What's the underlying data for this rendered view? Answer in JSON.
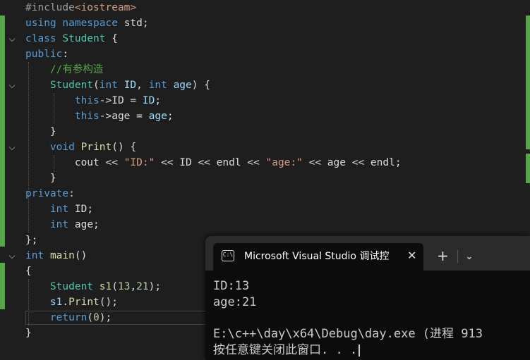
{
  "editor": {
    "lines": [
      {
        "parts": [
          {
            "c": "pp",
            "t": "#include"
          },
          {
            "c": "str",
            "t": "<iostream>"
          }
        ]
      },
      {
        "parts": [
          {
            "c": "kw",
            "t": "using"
          },
          {
            "c": "",
            "t": " "
          },
          {
            "c": "kw",
            "t": "namespace"
          },
          {
            "c": "",
            "t": " std;"
          }
        ]
      },
      {
        "parts": [
          {
            "c": "kw",
            "t": "class"
          },
          {
            "c": "",
            "t": " "
          },
          {
            "c": "ty",
            "t": "Student"
          },
          {
            "c": "",
            "t": " {"
          }
        ]
      },
      {
        "parts": [
          {
            "c": "kw",
            "t": "public"
          },
          {
            "c": "",
            "t": ":"
          }
        ]
      },
      {
        "parts": [
          {
            "c": "",
            "t": "    "
          },
          {
            "c": "cm",
            "t": "//有参构造"
          }
        ]
      },
      {
        "parts": [
          {
            "c": "",
            "t": "    "
          },
          {
            "c": "ty",
            "t": "Student"
          },
          {
            "c": "",
            "t": "("
          },
          {
            "c": "kw",
            "t": "int"
          },
          {
            "c": "",
            "t": " "
          },
          {
            "c": "var",
            "t": "ID"
          },
          {
            "c": "",
            "t": ", "
          },
          {
            "c": "kw",
            "t": "int"
          },
          {
            "c": "",
            "t": " "
          },
          {
            "c": "var",
            "t": "age"
          },
          {
            "c": "",
            "t": ") {"
          }
        ]
      },
      {
        "parts": [
          {
            "c": "",
            "t": "        "
          },
          {
            "c": "kw",
            "t": "this"
          },
          {
            "c": "",
            "t": "->ID = "
          },
          {
            "c": "var",
            "t": "ID"
          },
          {
            "c": "",
            "t": ";"
          }
        ]
      },
      {
        "parts": [
          {
            "c": "",
            "t": "        "
          },
          {
            "c": "kw",
            "t": "this"
          },
          {
            "c": "",
            "t": "->age = "
          },
          {
            "c": "var",
            "t": "age"
          },
          {
            "c": "",
            "t": ";"
          }
        ]
      },
      {
        "parts": [
          {
            "c": "",
            "t": "    }"
          }
        ]
      },
      {
        "parts": [
          {
            "c": "",
            "t": "    "
          },
          {
            "c": "kw",
            "t": "void"
          },
          {
            "c": "",
            "t": " "
          },
          {
            "c": "fn",
            "t": "Print"
          },
          {
            "c": "",
            "t": "() {"
          }
        ]
      },
      {
        "parts": [
          {
            "c": "",
            "t": "        cout << "
          },
          {
            "c": "str",
            "t": "\"ID:\""
          },
          {
            "c": "",
            "t": " << ID << endl << "
          },
          {
            "c": "str",
            "t": "\"age:\""
          },
          {
            "c": "",
            "t": " << age << endl;"
          }
        ]
      },
      {
        "parts": [
          {
            "c": "",
            "t": "    }"
          }
        ]
      },
      {
        "parts": [
          {
            "c": "kw",
            "t": "private"
          },
          {
            "c": "",
            "t": ":"
          }
        ]
      },
      {
        "parts": [
          {
            "c": "",
            "t": "    "
          },
          {
            "c": "kw",
            "t": "int"
          },
          {
            "c": "",
            "t": " ID;"
          }
        ]
      },
      {
        "parts": [
          {
            "c": "",
            "t": "    "
          },
          {
            "c": "kw",
            "t": "int"
          },
          {
            "c": "",
            "t": " age;"
          }
        ]
      },
      {
        "parts": [
          {
            "c": "",
            "t": "};"
          }
        ]
      },
      {
        "parts": [
          {
            "c": "kw",
            "t": "int"
          },
          {
            "c": "",
            "t": " "
          },
          {
            "c": "fn",
            "t": "main"
          },
          {
            "c": "",
            "t": "()"
          }
        ]
      },
      {
        "parts": [
          {
            "c": "",
            "t": "{"
          }
        ]
      },
      {
        "parts": [
          {
            "c": "",
            "t": "    "
          },
          {
            "c": "ty",
            "t": "Student"
          },
          {
            "c": "",
            "t": " "
          },
          {
            "c": "fn",
            "t": "s1"
          },
          {
            "c": "",
            "t": "("
          },
          {
            "c": "num",
            "t": "13"
          },
          {
            "c": "",
            "t": ","
          },
          {
            "c": "num",
            "t": "21"
          },
          {
            "c": "",
            "t": ");"
          }
        ]
      },
      {
        "parts": [
          {
            "c": "",
            "t": "    "
          },
          {
            "c": "var",
            "t": "s1"
          },
          {
            "c": "",
            "t": "."
          },
          {
            "c": "fn",
            "t": "Print"
          },
          {
            "c": "",
            "t": "();"
          }
        ]
      },
      {
        "parts": [
          {
            "c": "",
            "t": "    "
          },
          {
            "c": "kw",
            "t": "return"
          },
          {
            "c": "",
            "t": "("
          },
          {
            "c": "num",
            "t": "0"
          },
          {
            "c": "",
            "t": ");"
          }
        ]
      },
      {
        "parts": [
          {
            "c": "",
            "t": "}"
          }
        ]
      }
    ]
  },
  "terminal": {
    "tab_title": "Microsoft Visual Studio 调试控",
    "tab_icon_text": "C:\\",
    "close_glyph": "✕",
    "new_tab_glyph": "+",
    "dropdown_glyph": "⌄",
    "output": [
      "ID:13",
      "age:21",
      "",
      "E:\\c++\\day\\x64\\Debug\\day.exe (进程 913",
      "按任意键关闭此窗口. . ."
    ]
  },
  "colors": {
    "editor_bg": "#1e1e1e",
    "keyword": "#569cd6",
    "type": "#4ec9b0",
    "comment": "#57a64a",
    "terminal_bg": "#0c0c0c"
  }
}
